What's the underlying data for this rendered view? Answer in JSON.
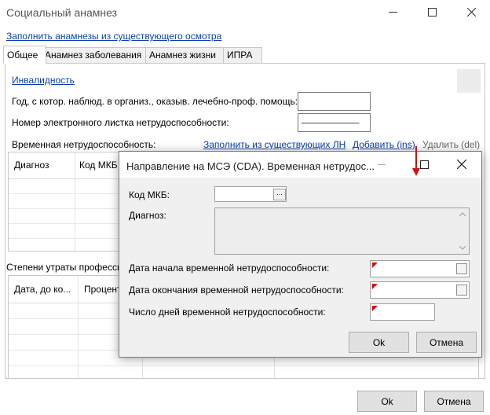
{
  "window": {
    "title": "Социальный анамнез",
    "minimize_icon": "minimize-icon",
    "maximize_icon": "maximize-icon",
    "close_icon": "close-icon"
  },
  "top_link": "Заполнить анамнезы из существующего осмотра",
  "tabs": [
    {
      "label": "Общее",
      "active": true
    },
    {
      "label": "Анамнез заболевания",
      "active": false
    },
    {
      "label": "Анамнез жизни",
      "active": false
    },
    {
      "label": "ИПРА",
      "active": false
    }
  ],
  "general": {
    "disability_link": "Инвалидность",
    "year_label": "Год, с котор. наблюд. в организ., оказыв. лечебно-проф. помощь:",
    "year_value": "",
    "sick_leave_label": "Номер электронного листка нетрудоспособности:",
    "sick_leave_value": "____________",
    "temp_disability_label": "Временная нетрудоспособность:",
    "fill_from_ln_link": "Заполнить из существующих ЛН",
    "add_link": "Добавить (ins)",
    "delete_link": "Удалить (del)",
    "temp_grid_headers": [
      "Диагноз",
      "Код МКБ"
    ],
    "loss_label": "Степени утраты професси",
    "loss_grid_headers": [
      "Дата, до ко...",
      "Процент"
    ]
  },
  "footer": {
    "ok_label": "Ok",
    "cancel_label": "Отмена"
  },
  "dialog": {
    "title": "Направление на МСЭ (CDA). Временная нетрудос...",
    "icd_label": "Код МКБ:",
    "icd_value": "",
    "icd_button": "...",
    "diagnosis_label": "Диагноз:",
    "diagnosis_value": "",
    "start_date_label": "Дата начала временной нетрудоспособности:",
    "start_date_value": "",
    "end_date_label": "Дата окончания временной нетрудоспособности:",
    "end_date_value": "",
    "days_label": "Число дней временной нетрудоспособности:",
    "days_value": "",
    "ok_label": "Ok",
    "cancel_label": "Отмена",
    "required_marker_color": "#d01010"
  },
  "annotation_arrow_color": "#d01010"
}
